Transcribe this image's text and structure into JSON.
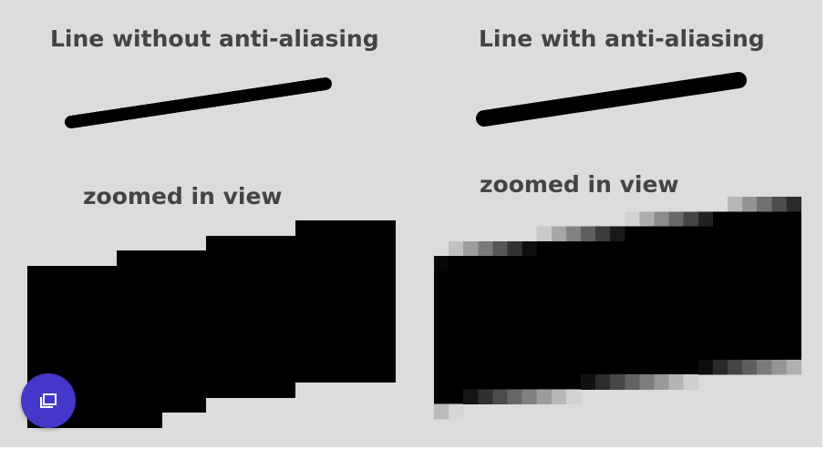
{
  "diagram": {
    "left_title": "Line without anti-aliasing",
    "right_title": "Line with anti-aliasing",
    "left_zoom_caption": "zoomed in view",
    "right_zoom_caption": "zoomed in view"
  },
  "colors": {
    "panel_background": "#dcdcdc",
    "caption_text": "#444444",
    "line": "#000000",
    "fab_background": "#4338c7"
  },
  "fab": {
    "icon": "gallery-view-icon"
  }
}
